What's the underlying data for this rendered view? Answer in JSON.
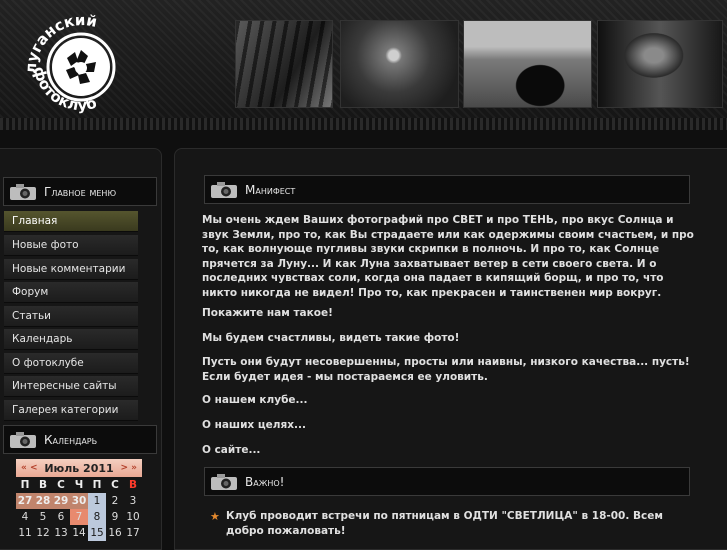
{
  "header": {
    "logo_text_top": "луганский",
    "logo_text_bottom": "фотоклуб"
  },
  "sidebar": {
    "menu_title": "Главное меню",
    "menu_items": [
      {
        "label": "Главная",
        "active": true
      },
      {
        "label": "Новые фото"
      },
      {
        "label": "Новые комментарии"
      },
      {
        "label": "Форум"
      },
      {
        "label": "Статьи"
      },
      {
        "label": "Календарь"
      },
      {
        "label": "О фотоклубе"
      },
      {
        "label": "Интересные сайты"
      },
      {
        "label": "Галерея категории"
      }
    ],
    "calendar_title": "Календарь"
  },
  "calendar": {
    "prev": "« <",
    "next": "> »",
    "month": "Июль 2011",
    "weekdays": [
      "П",
      "В",
      "С",
      "Ч",
      "П",
      "С",
      "В"
    ],
    "rows": [
      [
        "27",
        "28",
        "29",
        "30",
        "1",
        "2",
        "3"
      ],
      [
        "4",
        "5",
        "6",
        "7",
        "8",
        "9",
        "10"
      ],
      [
        "11",
        "12",
        "13",
        "14",
        "15",
        "16",
        "17"
      ]
    ]
  },
  "content": {
    "manifest_title": "Манифест",
    "paragraphs": [
      "Мы очень ждем Ваших фотографий про СВЕТ и про ТЕНЬ, про вкус Солнца и звук Земли, про то, как Вы страдаете или как одержимы своим счастьем, и про то, как волнующе пугливы звуки скрипки в полночь. И про то, как Солнце прячется за Луну... И как Луна захватывает ветер в сети своего света. И о последних чувствах соли, когда она падает в кипящий борщ, и про то, что никто никогда не видел! Про то, как прекрасен и таинственен мир вокруг.",
      "Покажите нам такое!",
      "Мы будем счастливы, видеть такие фото!",
      "Пусть они будут несовершенны, просты или наивны, низкого качества... пусть! Если будет идея - мы постараемся ее уловить.",
      "О нашем клубе...",
      "О наших целях...",
      "О сайте..."
    ],
    "important_title": "Важно!",
    "important_item": "Клуб проводит встречи по пятницам в ОДТИ \"СВЕТЛИЦА\" в 18-00. Всем добро пожаловать!"
  }
}
